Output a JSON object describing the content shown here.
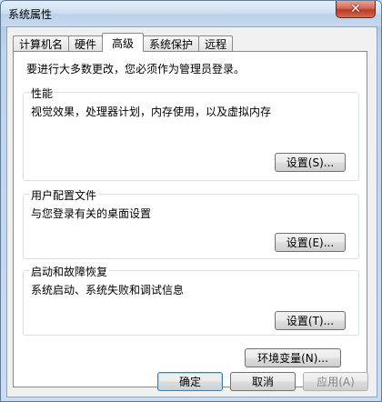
{
  "window": {
    "title": "系统属性",
    "close_label": "✕"
  },
  "tabs": [
    {
      "label": "计算机名"
    },
    {
      "label": "硬件"
    },
    {
      "label": "高级"
    },
    {
      "label": "系统保护"
    },
    {
      "label": "远程"
    }
  ],
  "active_tab": "高级",
  "notice": "要进行大多数更改，您必须作为管理员登录。",
  "groups": {
    "performance": {
      "title": "性能",
      "description": "视觉效果，处理器计划，内存使用，以及虚拟内存",
      "button_label": "设置(S)..."
    },
    "user_profiles": {
      "title": "用户配置文件",
      "description": "与您登录有关的桌面设置",
      "button_label": "设置(E)..."
    },
    "startup_recovery": {
      "title": "启动和故障恢复",
      "description": "系统启动、系统失败和调试信息",
      "button_label": "设置(T)..."
    }
  },
  "env_button_label": "环境变量(N)...",
  "footer": {
    "ok_label": "确定",
    "cancel_label": "取消",
    "apply_label": "应用(A)"
  }
}
